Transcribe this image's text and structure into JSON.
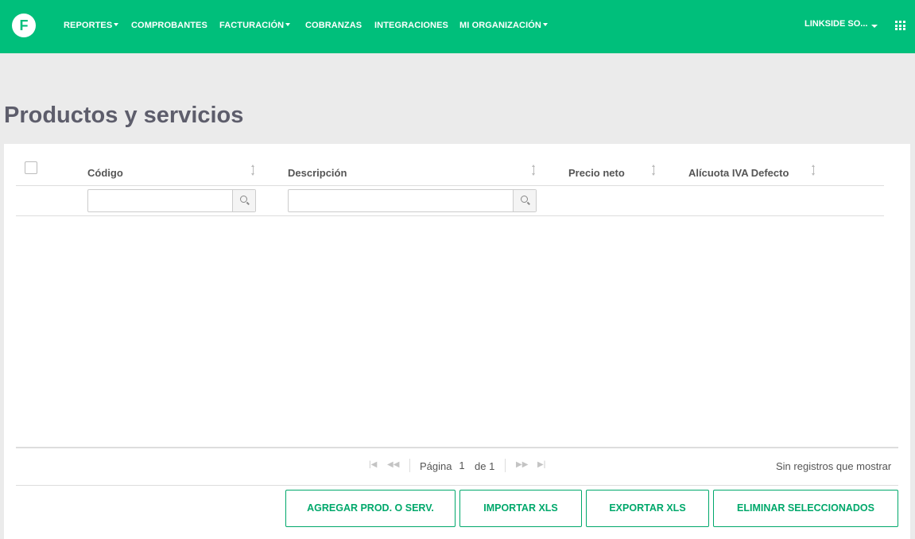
{
  "navbar": {
    "logo_letter": "F",
    "items": [
      {
        "label": "REPORTES",
        "has_dropdown": true
      },
      {
        "label": "COMPROBANTES",
        "has_dropdown": false
      },
      {
        "label": "FACTURACIÓN",
        "has_dropdown": true
      },
      {
        "label": "COBRANZAS",
        "has_dropdown": false
      },
      {
        "label": "INTEGRACIONES",
        "has_dropdown": false
      },
      {
        "label": "MI ORGANIZACIÓN",
        "has_dropdown": true
      }
    ],
    "user": "LINKSIDE SO...",
    "apps_icon": "grid-icon",
    "brand_color": "#00bf7b"
  },
  "page": {
    "title": "Productos y servicios"
  },
  "table": {
    "columns": [
      {
        "label": "Código",
        "filterable": true
      },
      {
        "label": "Descripción",
        "filterable": true
      },
      {
        "label": "Precio neto",
        "filterable": false
      },
      {
        "label": "Alícuota IVA Defecto",
        "filterable": false
      }
    ],
    "filters": {
      "codigo_value": "",
      "descripcion_value": ""
    },
    "rows": []
  },
  "pager": {
    "page_label": "Página",
    "current_page": "1",
    "of_label": "de 1",
    "empty_message": "Sin registros que mostrar"
  },
  "actions": {
    "add": "AGREGAR PROD. O SERV.",
    "import": "IMPORTAR XLS",
    "export": "EXPORTAR XLS",
    "delete": "ELIMINAR SELECCIONADOS",
    "accent_color": "#00a86b"
  }
}
